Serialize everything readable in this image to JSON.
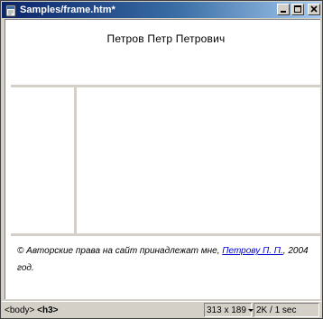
{
  "window": {
    "title": "Samples/frame.htm*",
    "buttons": {
      "minimize": "minimize",
      "maximize": "maximize",
      "close": "close"
    }
  },
  "document": {
    "heading": "Петров Петр Петрович",
    "footer": {
      "before_link": "© Авторские права на сайт принадлежат мне, ",
      "link": "Петрову П. П.",
      "after_link": ", 2004 год."
    }
  },
  "statusbar": {
    "tag_body": "<body>",
    "tag_h3": "<h3>",
    "window_size": "313 x 189",
    "download_stats": "2K / 1 sec"
  },
  "colors": {
    "title_gradient_start": "#0a246a",
    "title_gradient_end": "#a6caf0",
    "link": "#0000cc",
    "frame_border": "#d4d0c8"
  }
}
